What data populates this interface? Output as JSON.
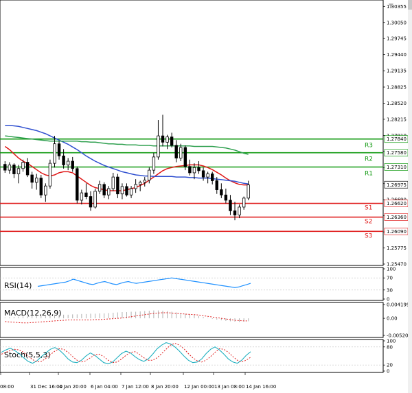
{
  "chart_data": {
    "type": "candlestick",
    "symbol": "",
    "price_axis": [
      "1.30355",
      "1.30050",
      "1.29745",
      "1.29440",
      "1.29135",
      "1.28825",
      "1.28520",
      "1.28215",
      "1.27910",
      "1.27605",
      "1.27300",
      "1.26995",
      "1.26690",
      "1.26385",
      "1.26080",
      "1.25775",
      "1.25470"
    ],
    "price_range": [
      1.2547,
      1.3045
    ],
    "time_axis": [
      "08:00",
      "31 Dec 16:00",
      "4 Jan 20:00",
      "6 Jan 04:00",
      "7 Jan 12:00",
      "8 Jan 20:00",
      "12 Jan 00:00",
      "13 Jan 08:00",
      "14 Jan 16:00"
    ],
    "current_price": {
      "label": "1.26975",
      "value": 1.26975
    },
    "levels": [
      {
        "name": "R3",
        "value": 1.2784,
        "label": "1.27840",
        "color": "#109910"
      },
      {
        "name": "R2",
        "value": 1.2758,
        "label": "1.27580",
        "color": "#109910"
      },
      {
        "name": "R1",
        "value": 1.2731,
        "label": "1.27310",
        "color": "#109910"
      },
      {
        "name": "S1",
        "value": 1.2662,
        "label": "1.26620",
        "color": "#e02020"
      },
      {
        "name": "S2",
        "value": 1.2636,
        "label": "1.26360",
        "color": "#e02020"
      },
      {
        "name": "S3",
        "value": 1.2609,
        "label": "1.26090",
        "color": "#e02020"
      }
    ],
    "candles": [
      [
        1.2736,
        1.2742,
        1.272,
        1.2725
      ],
      [
        1.2725,
        1.274,
        1.2718,
        1.2735
      ],
      [
        1.2735,
        1.2738,
        1.271,
        1.2718
      ],
      [
        1.2718,
        1.2735,
        1.27,
        1.2728
      ],
      [
        1.2728,
        1.2745,
        1.2722,
        1.274
      ],
      [
        1.274,
        1.2748,
        1.2712,
        1.2716
      ],
      [
        1.2716,
        1.2722,
        1.269,
        1.2702
      ],
      [
        1.2702,
        1.2718,
        1.2688,
        1.271
      ],
      [
        1.271,
        1.2716,
        1.2672,
        1.2678
      ],
      [
        1.2678,
        1.27,
        1.2665,
        1.2695
      ],
      [
        1.2695,
        1.2745,
        1.269,
        1.2738
      ],
      [
        1.2738,
        1.279,
        1.273,
        1.2775
      ],
      [
        1.2775,
        1.278,
        1.2745,
        1.2752
      ],
      [
        1.2752,
        1.2765,
        1.2728,
        1.2735
      ],
      [
        1.2735,
        1.2748,
        1.2725,
        1.2742
      ],
      [
        1.2742,
        1.275,
        1.2722,
        1.2728
      ],
      [
        1.2728,
        1.2732,
        1.2662,
        1.2668
      ],
      [
        1.2668,
        1.2688,
        1.266,
        1.2682
      ],
      [
        1.2682,
        1.27,
        1.267,
        1.2675
      ],
      [
        1.2675,
        1.2685,
        1.2648,
        1.2655
      ],
      [
        1.2655,
        1.269,
        1.2652,
        1.2685
      ],
      [
        1.2685,
        1.2705,
        1.268,
        1.2698
      ],
      [
        1.2698,
        1.2702,
        1.2672,
        1.2678
      ],
      [
        1.2678,
        1.2695,
        1.267,
        1.269
      ],
      [
        1.269,
        1.272,
        1.2685,
        1.2712
      ],
      [
        1.2712,
        1.2718,
        1.2672,
        1.268
      ],
      [
        1.268,
        1.27,
        1.267,
        1.2694
      ],
      [
        1.2694,
        1.27,
        1.2675,
        1.2678
      ],
      [
        1.2678,
        1.2695,
        1.2672,
        1.269
      ],
      [
        1.269,
        1.2708,
        1.2682,
        1.2698
      ],
      [
        1.2698,
        1.2705,
        1.2685,
        1.2702
      ],
      [
        1.2702,
        1.2712,
        1.2694,
        1.2706
      ],
      [
        1.2706,
        1.273,
        1.27,
        1.2725
      ],
      [
        1.2725,
        1.2758,
        1.2718,
        1.275
      ],
      [
        1.275,
        1.282,
        1.2745,
        1.279
      ],
      [
        1.279,
        1.283,
        1.277,
        1.2778
      ],
      [
        1.2778,
        1.2792,
        1.2765,
        1.2788
      ],
      [
        1.2788,
        1.2796,
        1.2768,
        1.2772
      ],
      [
        1.2772,
        1.2782,
        1.274,
        1.2748
      ],
      [
        1.2748,
        1.2775,
        1.2742,
        1.2768
      ],
      [
        1.2768,
        1.2772,
        1.2725,
        1.2732
      ],
      [
        1.2732,
        1.2745,
        1.2715,
        1.272
      ],
      [
        1.272,
        1.2738,
        1.2708,
        1.273
      ],
      [
        1.273,
        1.2742,
        1.2718,
        1.2724
      ],
      [
        1.2724,
        1.273,
        1.2705,
        1.2712
      ],
      [
        1.2712,
        1.2722,
        1.27,
        1.2718
      ],
      [
        1.2718,
        1.2722,
        1.2698,
        1.2705
      ],
      [
        1.2705,
        1.2712,
        1.268,
        1.2688
      ],
      [
        1.2688,
        1.27,
        1.2672,
        1.2678
      ],
      [
        1.2678,
        1.269,
        1.2662,
        1.2668
      ],
      [
        1.2668,
        1.2678,
        1.264,
        1.2648
      ],
      [
        1.2648,
        1.2665,
        1.263,
        1.264
      ],
      [
        1.264,
        1.266,
        1.2634,
        1.2655
      ],
      [
        1.2655,
        1.2675,
        1.265,
        1.2672
      ],
      [
        1.2672,
        1.2705,
        1.2668,
        1.2697
      ]
    ],
    "moving_averages": [
      {
        "color": "#e01818",
        "values": [
          1.277,
          1.2764,
          1.2756,
          1.2748,
          1.2742,
          1.2738,
          1.2732,
          1.2726,
          1.272,
          1.2716,
          1.2714,
          1.2716,
          1.272,
          1.2722,
          1.2722,
          1.272,
          1.2714,
          1.2708,
          1.2702,
          1.2696,
          1.2692,
          1.269,
          1.2688,
          1.2686,
          1.2686,
          1.2686,
          1.2686,
          1.2688,
          1.269,
          1.2692,
          1.2696,
          1.27,
          1.2706,
          1.2712,
          1.2718,
          1.2724,
          1.2728,
          1.273,
          1.2732,
          1.2733,
          1.2734,
          1.2735,
          1.2735,
          1.2735,
          1.2733,
          1.273,
          1.2726,
          1.2721,
          1.2716,
          1.271,
          1.2705,
          1.2701,
          1.2698,
          1.2697,
          1.2697
        ]
      },
      {
        "color": "#3050d0",
        "values": [
          1.281,
          1.281,
          1.2809,
          1.2808,
          1.2806,
          1.2804,
          1.2802,
          1.28,
          1.2797,
          1.2794,
          1.279,
          1.2786,
          1.2782,
          1.2778,
          1.2774,
          1.2769,
          1.2764,
          1.2758,
          1.2752,
          1.2747,
          1.2742,
          1.2738,
          1.2734,
          1.2731,
          1.2728,
          1.2725,
          1.2722,
          1.272,
          1.2718,
          1.2716,
          1.2715,
          1.2714,
          1.2714,
          1.2713,
          1.2713,
          1.2713,
          1.2713,
          1.2713,
          1.2712,
          1.2712,
          1.2712,
          1.2711,
          1.2711,
          1.271,
          1.271,
          1.271,
          1.2709,
          1.2708,
          1.2707,
          1.2706,
          1.2705,
          1.2704,
          1.2702,
          1.27,
          1.2699
        ]
      },
      {
        "color": "#30a050",
        "values": [
          1.279,
          1.2789,
          1.2788,
          1.2787,
          1.2786,
          1.2785,
          1.2784,
          1.2783,
          1.2782,
          1.2781,
          1.278,
          1.278,
          1.278,
          1.278,
          1.278,
          1.278,
          1.278,
          1.2779,
          1.2779,
          1.2778,
          1.2778,
          1.2777,
          1.2776,
          1.2775,
          1.2775,
          1.2774,
          1.2774,
          1.2773,
          1.2773,
          1.2773,
          1.2772,
          1.2772,
          1.2772,
          1.2771,
          1.2771,
          1.2771,
          1.2771,
          1.2771,
          1.2771,
          1.2771,
          1.2771,
          1.2771,
          1.277,
          1.277,
          1.277,
          1.277,
          1.277,
          1.2769,
          1.2768,
          1.2767,
          1.2765,
          1.2763,
          1.276,
          1.2757,
          1.2755
        ]
      }
    ],
    "rsi": {
      "title": "RSI(14)",
      "axis": [
        "100",
        "70",
        "30",
        "0"
      ],
      "range": [
        0,
        100
      ],
      "values": [
        42,
        44,
        46,
        48,
        50,
        52,
        54,
        56,
        60,
        66,
        62,
        58,
        54,
        50,
        48,
        52,
        56,
        58,
        54,
        50,
        48,
        52,
        56,
        58,
        54,
        52,
        54,
        56,
        58,
        60,
        62,
        64,
        66,
        68,
        70,
        68,
        66,
        64,
        62,
        60,
        58,
        56,
        54,
        52,
        50,
        48,
        46,
        44,
        42,
        40,
        38,
        40,
        44,
        48,
        52
      ]
    },
    "macd": {
      "title": "MACD(12,26,9)",
      "axis": [
        "0.004199",
        "0.00",
        "-0.005205"
      ],
      "range": [
        -0.005205,
        0.004199
      ],
      "histogram": [
        0.0002,
        0.0003,
        0.0004,
        0.0005,
        0.0006,
        0.0006,
        0.0007,
        0.0008,
        0.0008,
        0.0009,
        0.0009,
        0.001,
        0.001,
        0.0011,
        0.0011,
        0.0012,
        0.0012,
        0.0013,
        0.0013,
        0.0014,
        0.0014,
        0.0015,
        0.0015,
        0.0016,
        0.0017,
        0.0018,
        0.0019,
        0.0019,
        0.002,
        0.002,
        0.0021,
        0.0022,
        0.0023,
        0.0024,
        0.0024,
        0.0023,
        0.0022,
        0.002,
        0.0018,
        0.0016,
        0.0014,
        0.0012,
        0.001,
        0.0007,
        0.0004,
        0.0001,
        -0.0002,
        -0.0004,
        -0.0006,
        -0.0008,
        -0.0009,
        -0.001,
        -0.0011,
        -0.001,
        -0.0009
      ],
      "signal": [
        -0.001,
        -0.0011,
        -0.0012,
        -0.0013,
        -0.0014,
        -0.0014,
        -0.0013,
        -0.0012,
        -0.0011,
        -0.001,
        -0.0009,
        -0.0008,
        -0.0007,
        -0.0006,
        -0.0005,
        -0.0005,
        -0.0005,
        -0.0005,
        -0.0005,
        -0.0005,
        -0.0004,
        -0.0004,
        -0.0003,
        -0.0002,
        -0.0001,
        0.0,
        0.0001,
        0.0003,
        0.0005,
        0.0007,
        0.0009,
        0.0011,
        0.0013,
        0.0015,
        0.0016,
        0.0017,
        0.0017,
        0.0016,
        0.0015,
        0.0014,
        0.0013,
        0.0012,
        0.0011,
        0.001,
        0.0008,
        0.0006,
        0.0004,
        0.0002,
        0.0,
        -0.0002,
        -0.0004,
        -0.0006,
        -0.0007,
        -0.0008,
        -0.0008
      ]
    },
    "stoch": {
      "title": "Stoch(5,5,3)",
      "axis": [
        "100",
        "80",
        "20",
        "0"
      ],
      "range": [
        0,
        100
      ],
      "main": [
        62,
        70,
        76,
        68,
        58,
        44,
        32,
        26,
        34,
        48,
        60,
        72,
        78,
        70,
        56,
        40,
        30,
        28,
        36,
        50,
        60,
        52,
        40,
        28,
        24,
        30,
        44,
        58,
        66,
        60,
        48,
        38,
        32,
        40,
        56,
        74,
        86,
        94,
        90,
        80,
        66,
        50,
        36,
        28,
        30,
        40,
        58,
        72,
        80,
        70,
        56,
        40,
        30,
        26,
        36,
        52,
        64
      ],
      "signal": [
        56,
        62,
        68,
        72,
        70,
        62,
        50,
        38,
        30,
        32,
        42,
        54,
        66,
        74,
        72,
        62,
        48,
        36,
        30,
        34,
        44,
        54,
        56,
        48,
        36,
        28,
        30,
        40,
        52,
        62,
        64,
        56,
        44,
        36,
        36,
        44,
        58,
        72,
        86,
        92,
        86,
        74,
        58,
        44,
        34,
        30,
        36,
        48,
        62,
        74,
        72,
        62,
        48,
        36,
        30,
        36,
        46
      ]
    }
  }
}
